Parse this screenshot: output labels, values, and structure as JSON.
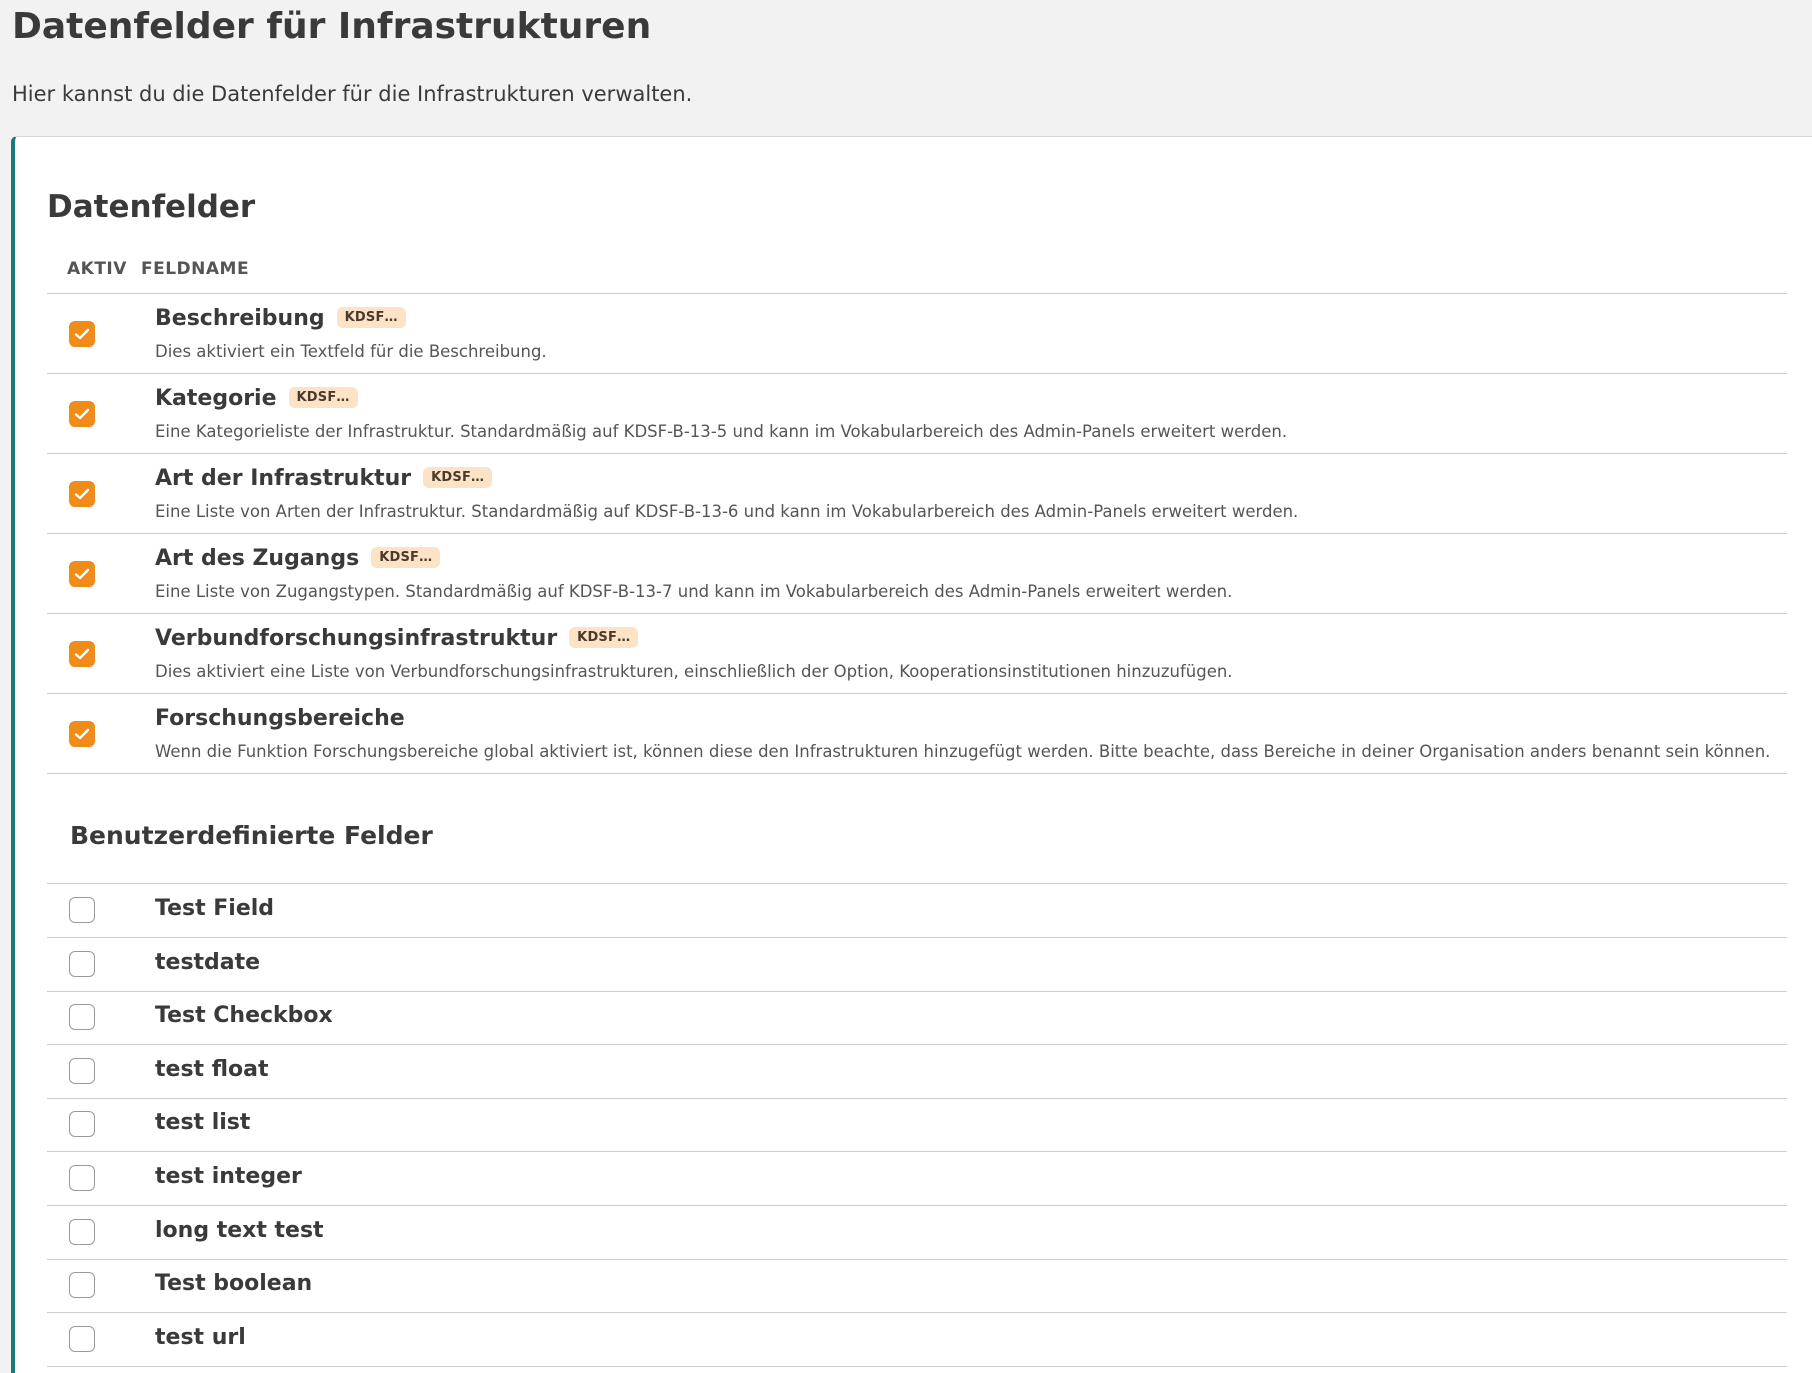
{
  "header": {
    "title": "Datenfelder für Infrastrukturen",
    "subtitle": "Hier kannst du die Datenfelder für die Infrastrukturen verwalten."
  },
  "datafields": {
    "title": "Datenfelder",
    "columns": {
      "active": "AKTIV",
      "name": "FELDNAME"
    },
    "rows": [
      {
        "name": "Beschreibung",
        "badge": "KDSF…",
        "desc": "Dies aktiviert ein Textfeld für die Beschreibung.",
        "checked": true
      },
      {
        "name": "Kategorie",
        "badge": "KDSF…",
        "desc": "Eine Kategorieliste der Infrastruktur. Standardmäßig auf KDSF-B-13-5 und kann im Vokabularbereich des Admin-Panels erweitert werden.",
        "checked": true
      },
      {
        "name": "Art der Infrastruktur",
        "badge": "KDSF…",
        "desc": "Eine Liste von Arten der Infrastruktur. Standardmäßig auf KDSF-B-13-6 und kann im Vokabularbereich des Admin-Panels erweitert werden.",
        "checked": true
      },
      {
        "name": "Art des Zugangs",
        "badge": "KDSF…",
        "desc": "Eine Liste von Zugangstypen. Standardmäßig auf KDSF-B-13-7 und kann im Vokabularbereich des Admin-Panels erweitert werden.",
        "checked": true
      },
      {
        "name": "Verbundforschungsinfrastruktur",
        "badge": "KDSF…",
        "desc": "Dies aktiviert eine Liste von Verbundforschungsinfrastrukturen, einschließlich der Option, Kooperationsinstitutionen hinzuzufügen.",
        "checked": true
      },
      {
        "name": "Forschungsbereiche",
        "badge": "",
        "desc": "Wenn die Funktion Forschungsbereiche global aktiviert ist, können diese den Infrastrukturen hinzugefügt werden. Bitte beachte, dass Bereiche in deiner Organisation anders benannt sein können.",
        "checked": true
      }
    ]
  },
  "custom": {
    "title": "Benutzerdefinierte Felder",
    "rows": [
      {
        "name": "Test Field",
        "checked": false
      },
      {
        "name": "testdate",
        "checked": false
      },
      {
        "name": "Test Checkbox",
        "checked": false
      },
      {
        "name": "test float",
        "checked": false
      },
      {
        "name": "test list",
        "checked": false
      },
      {
        "name": "test integer",
        "checked": false
      },
      {
        "name": "long text test",
        "checked": false
      },
      {
        "name": "Test boolean",
        "checked": false
      },
      {
        "name": "test url",
        "checked": false
      }
    ]
  },
  "colors": {
    "accent_checkbox": "#f28c18",
    "badge_bg": "#fde3c6",
    "card_border": "#177a7c"
  },
  "icons": {
    "check": "check-icon"
  }
}
